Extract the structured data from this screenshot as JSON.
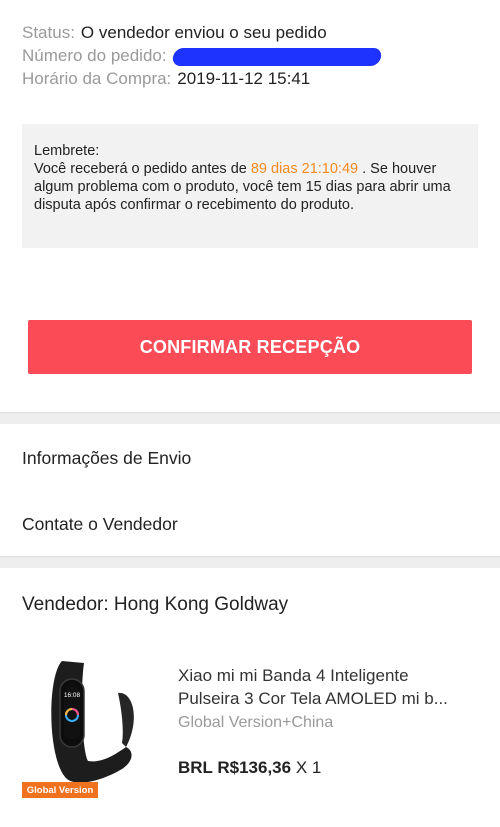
{
  "status": {
    "label": "Status:",
    "value": "O vendedor enviou o seu pedido"
  },
  "order_number": {
    "label": "Número do pedido:"
  },
  "purchase_time": {
    "label": "Horário da Compra:",
    "value": "2019-11-12 15:41"
  },
  "reminder": {
    "title": "Lembrete:",
    "text_before": "Você receberá o pedido antes de ",
    "countdown": "89 dias 21:10:49",
    "text_after": " . Se houver algum problema com o produto, você tem 15 dias para abrir uma disputa após confirmar o recebimento do produto."
  },
  "confirm_button": "CONFIRMAR RECEPÇÃO",
  "menu": {
    "shipping_info": "Informações de Envio",
    "contact_seller": "Contate o Vendedor"
  },
  "seller": "Vendedor: Hong Kong Goldway",
  "product": {
    "title_line1": "Xiao mi mi Banda 4 Inteligente",
    "title_line2": "Pulseira 3 Cor Tela AMOLED mi b...",
    "variant": "Global Version+China",
    "price": "BRL R$136,36",
    "quantity": "X 1",
    "badge": "Global Version",
    "screen_time": "16:08"
  },
  "colors": {
    "accent_orange": "#f58a1f",
    "button_red": "#fa4b57",
    "redaction_blue": "#1f33ff"
  }
}
